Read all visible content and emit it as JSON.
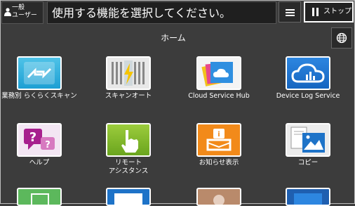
{
  "header": {
    "user_label_line1": "一般",
    "user_label_line2": "ユーザー",
    "message": "使用する機能を選択してください。",
    "stop_label": "ストップ"
  },
  "page": {
    "title": "ホーム"
  },
  "tiles": [
    {
      "label": "業務別 らくらくスキャン"
    },
    {
      "label": "スキャンオート"
    },
    {
      "label": "Cloud Service Hub"
    },
    {
      "label": "Device Log Service"
    },
    {
      "label": "ヘルプ"
    },
    {
      "label": "リモート\nアシスタンス"
    },
    {
      "label": "お知らせ表示"
    },
    {
      "label": "コピー"
    }
  ],
  "icons": [
    "user-icon",
    "menu-icon",
    "stop-icon",
    "globe-icon",
    "scan-arrows-icon",
    "scan-auto-icon",
    "cloud-service-icon",
    "device-log-cloud-icon",
    "help-icon",
    "remote-assist-icon",
    "notice-icon",
    "copy-icon"
  ],
  "colors": {
    "background": "#3c3c3c",
    "message_bar": "#1f1f1f"
  }
}
